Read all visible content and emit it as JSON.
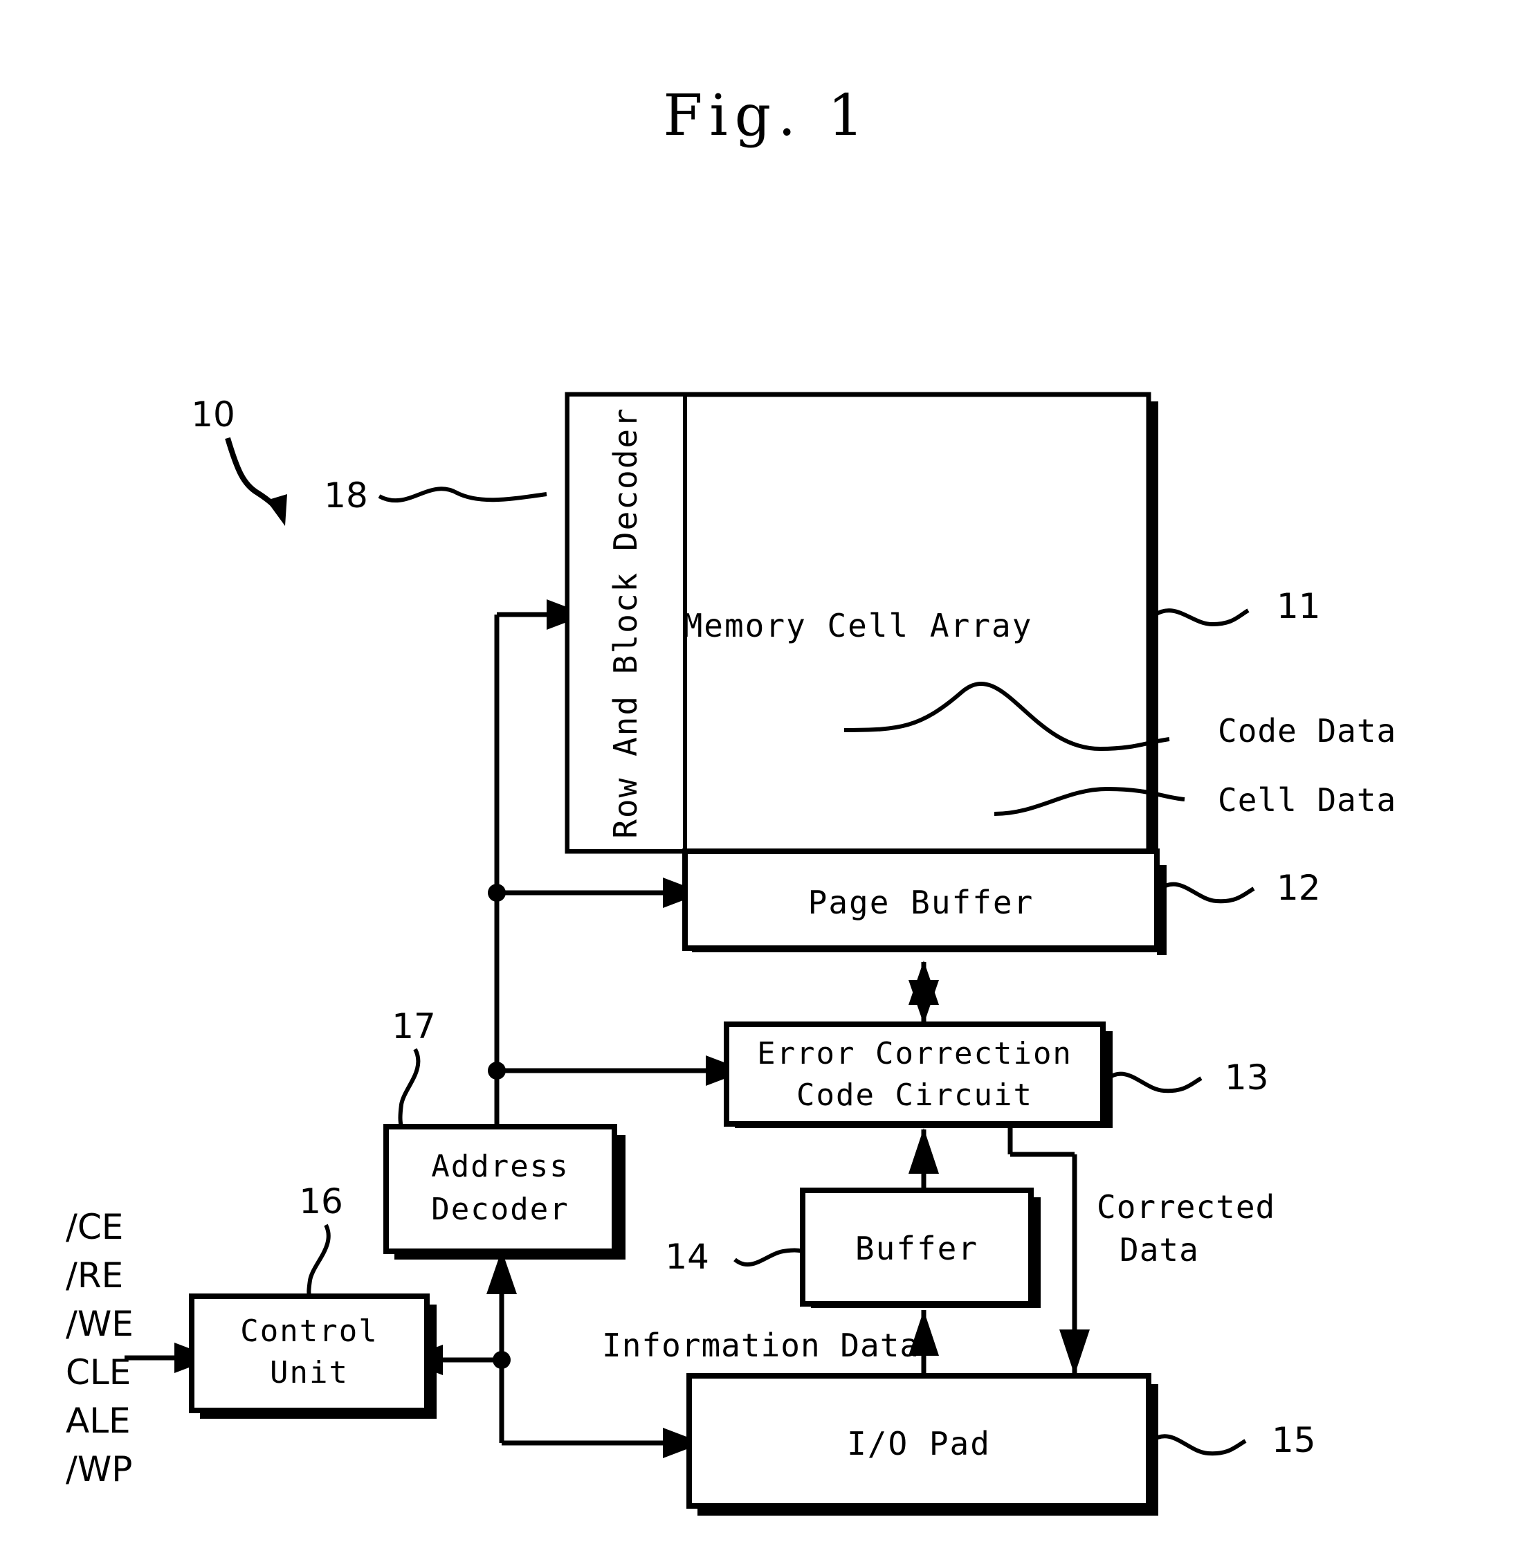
{
  "figure": {
    "title": "Fig. 1",
    "overall_ref": "10"
  },
  "blocks": {
    "row_block_decoder": {
      "label": "Row And Block Decoder",
      "ref": "18"
    },
    "memory_cell_array": {
      "label": "Memory Cell Array",
      "ref": "11"
    },
    "page_buffer": {
      "label": "Page Buffer",
      "ref": "12"
    },
    "ecc_circuit": {
      "label_line1": "Error Correction",
      "label_line2": "Code Circuit",
      "ref": "13"
    },
    "buffer": {
      "label": "Buffer",
      "ref": "14"
    },
    "io_pad": {
      "label": "I/O Pad",
      "ref": "15"
    },
    "control_unit": {
      "label_line1": "Control",
      "label_line2": "Unit",
      "ref": "16"
    },
    "address_decoder": {
      "label_line1": "Address",
      "label_line2": "Decoder",
      "ref": "17"
    }
  },
  "annotations": {
    "code_data": "Code Data",
    "cell_data": "Cell Data",
    "information_data": "Information Data",
    "corrected_data_line1": "Corrected",
    "corrected_data_line2": "Data"
  },
  "signals": [
    "/CE",
    "/RE",
    "/WE",
    "CLE",
    "ALE",
    "/WP"
  ],
  "colors": {
    "ink": "#000000",
    "paper": "#ffffff"
  }
}
